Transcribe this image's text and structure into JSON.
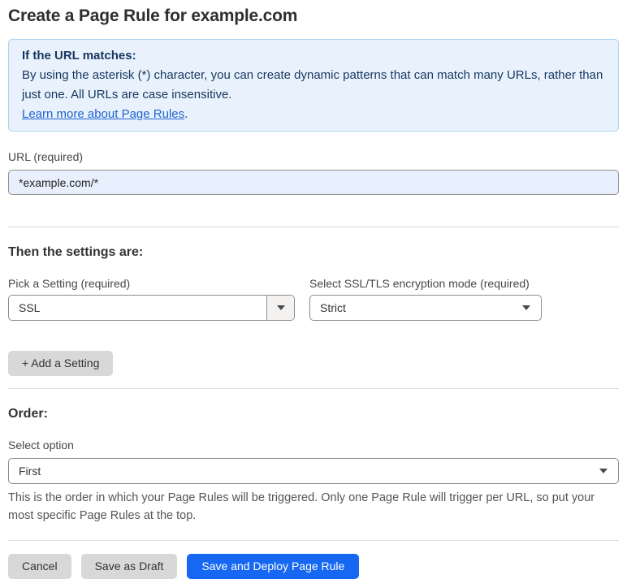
{
  "page": {
    "title": "Create a Page Rule for example.com"
  },
  "info_box": {
    "heading": "If the URL matches:",
    "body": "By using the asterisk (*) character, you can create dynamic patterns that can match many URLs, rather than just one. All URLs are case insensitive.",
    "link": "Learn more about Page Rules",
    "link_suffix": "."
  },
  "url_field": {
    "label": "URL (required)",
    "value": "*example.com/*"
  },
  "settings_section": {
    "heading": "Then the settings are:",
    "setting_select": {
      "label": "Pick a Setting (required)",
      "value": "SSL"
    },
    "mode_select": {
      "label": "Select SSL/TLS encryption mode (required)",
      "value": "Strict"
    },
    "add_setting_label": "+ Add a Setting"
  },
  "order_section": {
    "heading": "Order:",
    "select_label": "Select option",
    "value": "First",
    "help_text": "This is the order in which your Page Rules will be triggered. Only one Page Rule will trigger per URL, so put your most specific Page Rules at the top."
  },
  "footer": {
    "cancel_label": "Cancel",
    "save_draft_label": "Save as Draft",
    "save_deploy_label": "Save and Deploy Page Rule"
  },
  "icons": {
    "dropdown_arrow": "triangle-down"
  },
  "colors": {
    "accent_blue": "#1668f3",
    "info_bg": "#e9f2fc",
    "info_border": "#abd2f1",
    "info_text": "#16365f",
    "link_blue": "#2063d1",
    "input_autofill_bg": "#e8f0fe",
    "button_gray": "#d8d8d8"
  }
}
